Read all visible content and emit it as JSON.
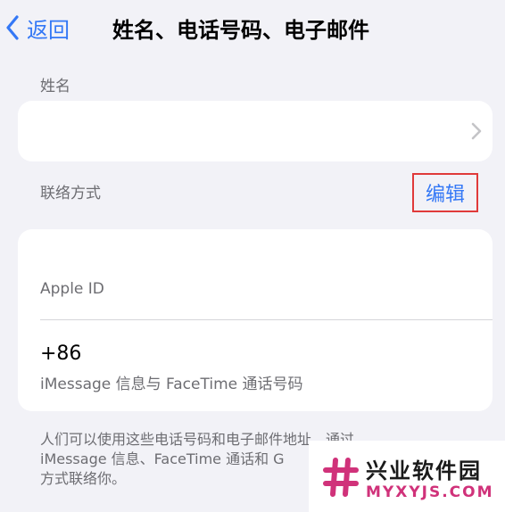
{
  "nav": {
    "back_label": "返回",
    "title": "姓名、电话号码、电子邮件"
  },
  "name_section": {
    "header": "姓名"
  },
  "contact_section": {
    "header": "联络方式",
    "edit_label": "编辑",
    "apple_id_label": "Apple ID",
    "phone_number": "+86",
    "phone_caption": "iMessage 信息与 FaceTime 通话号码"
  },
  "footer": {
    "lines": [
      "人们可以使用这些电话号码和电子邮件地址，通过",
      "iMessage 信息、FaceTime 通话和 G",
      "方式联络你。"
    ]
  },
  "watermark": {
    "title": "兴业软件园",
    "url": "MYXYJS.COM"
  },
  "colors": {
    "accent": "#3478f6",
    "highlight_border": "#e03a3a",
    "background": "#f2f2f7",
    "watermark_pink": "#d0327a"
  },
  "icons": {
    "back": "chevron-left-icon",
    "disclosure": "chevron-right-icon",
    "watermark": "hash-logo-icon"
  }
}
